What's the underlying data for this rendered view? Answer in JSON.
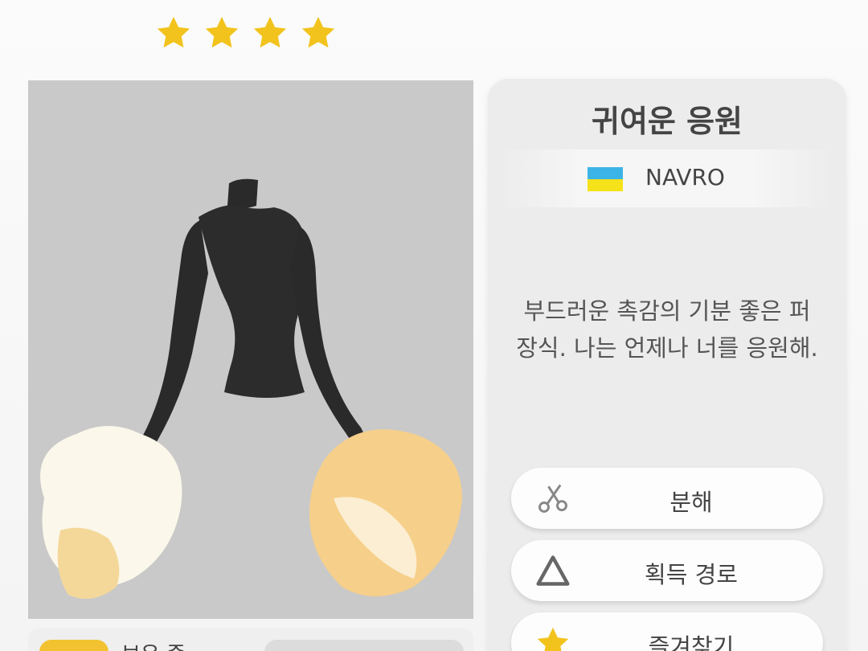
{
  "rating": {
    "stars": 4,
    "star_color": "#f2c31c"
  },
  "item": {
    "title": "귀여운 응원",
    "brand": "NAVRO",
    "flag_colors": [
      "#3cb4e5",
      "#f6e21a"
    ],
    "description_line1": "부드러운 촉감의 기분 좋은 퍼",
    "description_line2": "장식. 나는 언제나 너를 응원해."
  },
  "actions": {
    "dismantle": {
      "label": "분해",
      "icon": "scissors-icon"
    },
    "source": {
      "label": "획득 경로",
      "icon": "triangle-icon"
    },
    "favorite": {
      "label": "즐겨찾기",
      "icon": "star-icon"
    }
  },
  "bottom": {
    "owned_label": "보유 중"
  },
  "colors": {
    "preview_bg": "#c9c9c9",
    "panel_bg": "#ececec",
    "accent": "#f3c230"
  }
}
